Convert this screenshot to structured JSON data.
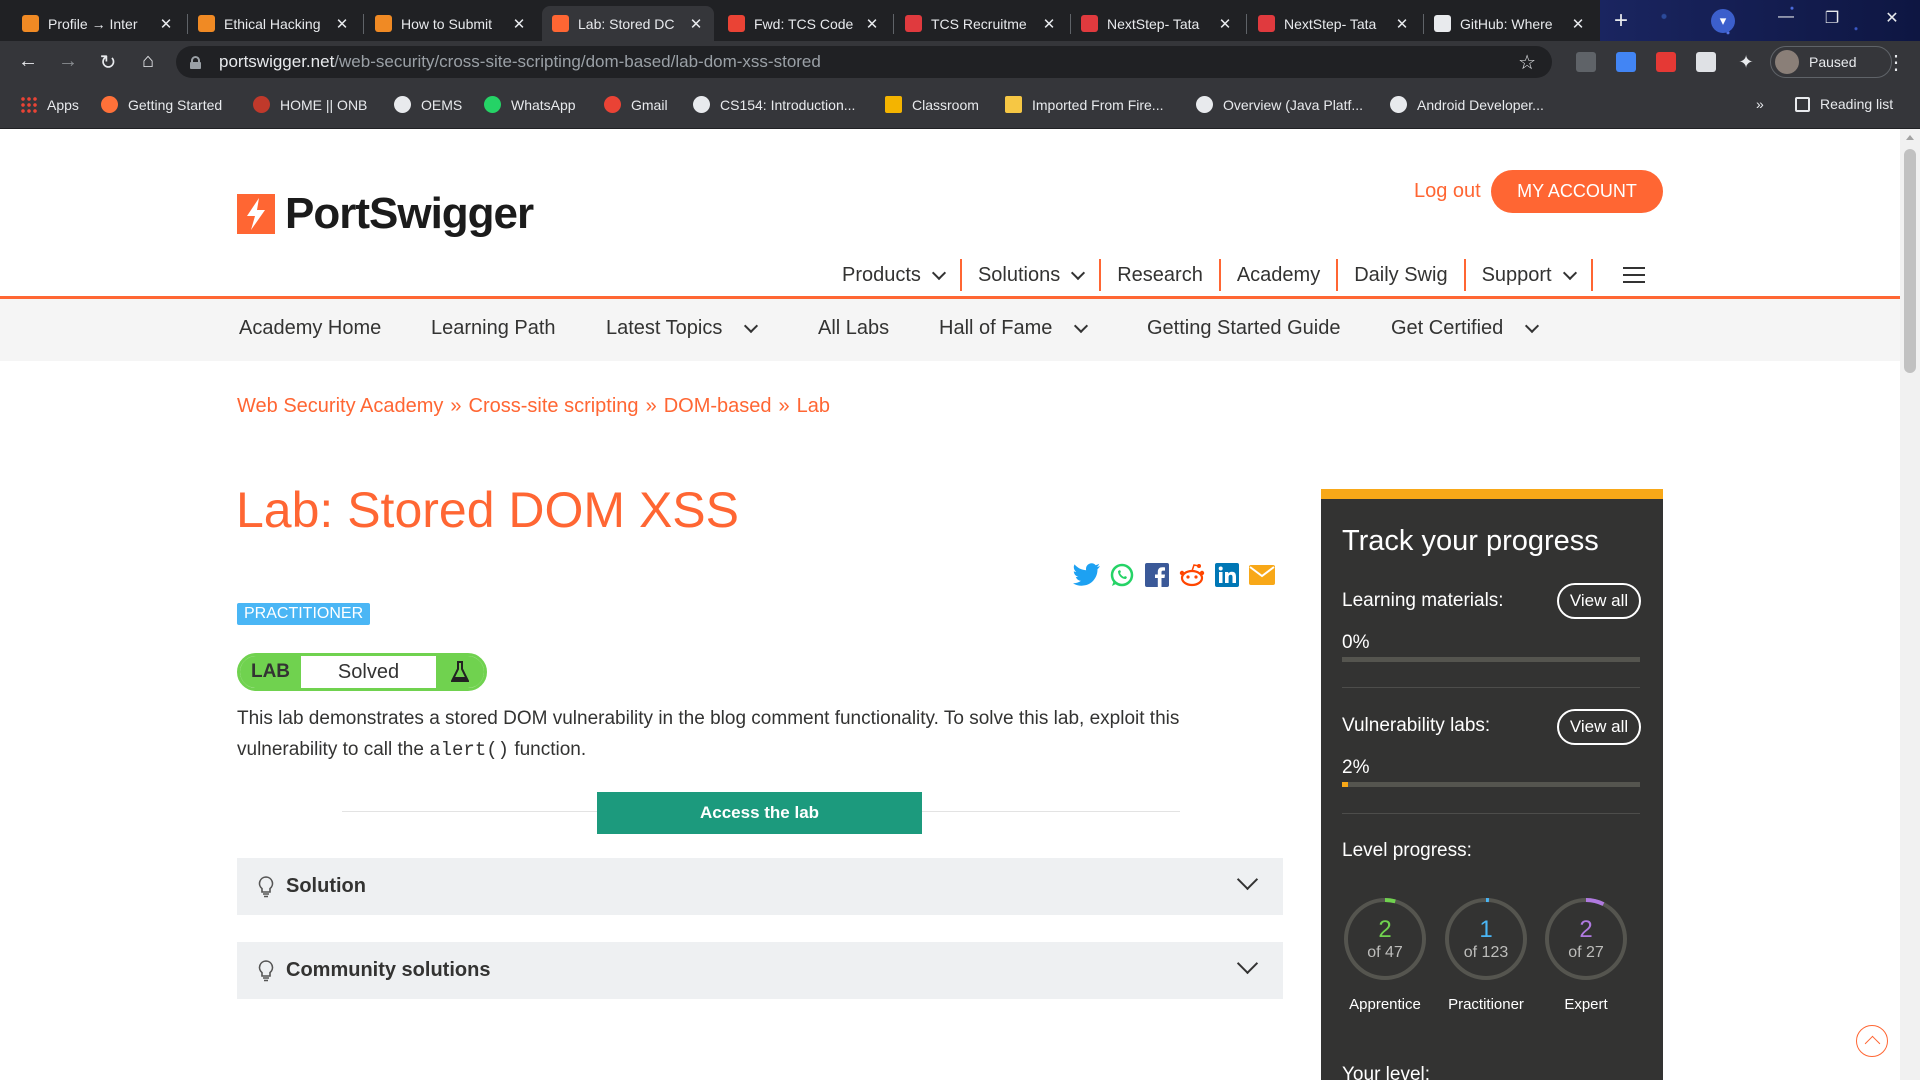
{
  "browser": {
    "tabs": [
      {
        "title": "Profile → Inter",
        "fav_color": "#f08a24",
        "active": false
      },
      {
        "title": "Ethical Hacking",
        "fav_color": "#f08a24",
        "active": false
      },
      {
        "title": "How to Submit",
        "fav_color": "#f08a24",
        "active": false
      },
      {
        "title": "Lab: Stored DC",
        "fav_color": "#ff6633",
        "active": true
      },
      {
        "title": "Fwd: TCS Code",
        "fav_color": "#ea4335",
        "active": false
      },
      {
        "title": "TCS Recruitme",
        "fav_color": "#e03a3e",
        "active": false
      },
      {
        "title": "NextStep- Tata",
        "fav_color": "#e03a3e",
        "active": false
      },
      {
        "title": "NextStep- Tata",
        "fav_color": "#e03a3e",
        "active": false
      },
      {
        "title": "GitHub: Where",
        "fav_color": "#e8eaed",
        "active": false
      }
    ],
    "url_host": "portswigger.net",
    "url_path": "/web-security/cross-site-scripting/dom-based/lab-dom-xss-stored",
    "profile_status": "Paused",
    "bookmarks": [
      {
        "label": "Apps",
        "icon": "apps-grid-icon"
      },
      {
        "label": "Getting Started",
        "icon": "firefox-icon",
        "color": "#ff7139"
      },
      {
        "label": "HOME || ONB",
        "icon": "x-logo-icon",
        "color": "#c0392b"
      },
      {
        "label": "OEMS",
        "icon": "globe-icon",
        "color": "#e8eaed"
      },
      {
        "label": "WhatsApp",
        "icon": "whatsapp-icon",
        "color": "#25d366"
      },
      {
        "label": "Gmail",
        "icon": "gmail-icon",
        "color": "#ea4335"
      },
      {
        "label": "CS154: Introduction...",
        "icon": "globe-icon",
        "color": "#e8eaed"
      },
      {
        "label": "Classroom",
        "icon": "classroom-icon",
        "color": "#f4b400"
      },
      {
        "label": "Imported From Fire...",
        "icon": "folder-icon",
        "color": "#f6c744"
      },
      {
        "label": "Overview (Java Platf...",
        "icon": "globe-icon",
        "color": "#e8eaed"
      },
      {
        "label": "Android Developer...",
        "icon": "globe-icon",
        "color": "#e8eaed"
      }
    ],
    "more_bookmarks": "»",
    "reading_list": "Reading list"
  },
  "header": {
    "logo_text": "PortSwigger",
    "logout": "Log out",
    "my_account": "MY ACCOUNT",
    "main_nav": [
      {
        "label": "Products",
        "dropdown": true
      },
      {
        "label": "Solutions",
        "dropdown": true
      },
      {
        "label": "Research",
        "dropdown": false
      },
      {
        "label": "Academy",
        "dropdown": false
      },
      {
        "label": "Daily Swig",
        "dropdown": false
      },
      {
        "label": "Support",
        "dropdown": true
      }
    ]
  },
  "subnav": [
    {
      "label": "Academy Home",
      "dropdown": false
    },
    {
      "label": "Learning Path",
      "dropdown": false
    },
    {
      "label": "Latest Topics",
      "dropdown": true
    },
    {
      "label": "All Labs",
      "dropdown": false
    },
    {
      "label": "Hall of Fame",
      "dropdown": true
    },
    {
      "label": "Getting Started Guide",
      "dropdown": false
    },
    {
      "label": "Get Certified",
      "dropdown": true
    }
  ],
  "breadcrumb": [
    "Web Security Academy",
    "Cross-site scripting",
    "DOM-based",
    "Lab"
  ],
  "breadcrumb_sep": "»",
  "lab": {
    "title": "Lab: Stored DOM XSS",
    "level_badge": "PRACTITIONER",
    "status_tag": "LAB",
    "status": "Solved",
    "description_1": "This lab demonstrates a stored DOM vulnerability in the blog comment functionality. To solve this lab, exploit this vulnerability to call the ",
    "description_code": "alert()",
    "description_2": " function.",
    "access_button": "Access the lab",
    "sections": [
      "Solution",
      "Community solutions"
    ]
  },
  "share_icons": [
    "twitter-icon",
    "whatsapp-icon",
    "facebook-icon",
    "reddit-icon",
    "linkedin-icon",
    "email-icon"
  ],
  "progress": {
    "title": "Track your progress",
    "learning_label": "Learning materials:",
    "learning_pct": "0%",
    "learning_fraction": 0.0,
    "labs_label": "Vulnerability labs:",
    "labs_pct": "2%",
    "labs_fraction": 0.02,
    "view_all": "View all",
    "level_label": "Level progress:",
    "levels": [
      {
        "name": "Apprentice",
        "done": "2",
        "total": "of 47",
        "color": "#70d24f",
        "fraction": 0.0426
      },
      {
        "name": "Practitioner",
        "done": "1",
        "total": "of 123",
        "color": "#4ab6f5",
        "fraction": 0.0081
      },
      {
        "name": "Expert",
        "done": "2",
        "total": "of 27",
        "color": "#b07ae0",
        "fraction": 0.074
      }
    ],
    "your_level": "Your level:"
  }
}
